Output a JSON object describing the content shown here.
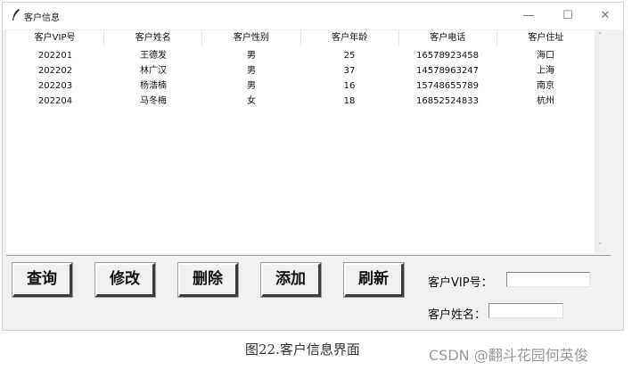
{
  "window": {
    "title": "客户信息",
    "min_glyph": "—",
    "max_glyph": "☐",
    "close_glyph": "✕"
  },
  "table": {
    "headers": [
      "客户VIP号",
      "客户姓名",
      "客户性别",
      "客户年龄",
      "客户电话",
      "客户住址"
    ],
    "rows": [
      [
        "202201",
        "王德发",
        "男",
        "25",
        "16578923458",
        "海口"
      ],
      [
        "202202",
        "林广汉",
        "男",
        "37",
        "14578963247",
        "上海"
      ],
      [
        "202203",
        "杨浩楠",
        "男",
        "16",
        "15748655789",
        "南京"
      ],
      [
        "202204",
        "马冬梅",
        "女",
        "18",
        "16852524833",
        "杭州"
      ]
    ]
  },
  "scrollbar": {
    "up_glyph": "˄",
    "down_glyph": "˅"
  },
  "buttons": {
    "query": "查询",
    "modify": "修改",
    "delete": "删除",
    "add": "添加",
    "refresh": "刷新"
  },
  "form": {
    "vip_label": "客户VIP号：",
    "vip_value": "",
    "name_label": "客户姓名：",
    "name_value": ""
  },
  "caption": "图22.客户信息界面",
  "watermark": "CSDN @翻斗花园何英俊"
}
